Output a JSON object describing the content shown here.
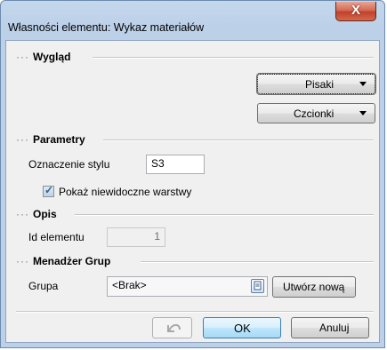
{
  "window": {
    "title": "Własności elementu: Wykaz materiałów",
    "close_glyph": "X"
  },
  "sections": {
    "appearance": {
      "title": "Wygląd",
      "dots": "···"
    },
    "parameters": {
      "title": "Parametry",
      "dots": "···"
    },
    "description": {
      "title": "Opis",
      "dots": "···"
    },
    "group_manager": {
      "title": "Menadżer Grup",
      "dots": "···"
    }
  },
  "appearance": {
    "pens_label": "Pisaki",
    "fonts_label": "Czcionki"
  },
  "parameters": {
    "style_label": "Oznaczenie stylu",
    "style_value": "S3",
    "show_hidden_label": "Pokaż niewidoczne warstwy",
    "show_hidden_checked": true
  },
  "description": {
    "element_id_label": "Id elementu",
    "element_id_value": "1"
  },
  "group_manager": {
    "group_label": "Grupa",
    "group_value": "<Brak>",
    "create_new_label": "Utwórz nową"
  },
  "footer": {
    "ok_label": "OK",
    "cancel_label": "Anuluj",
    "undo_icon": "undo-icon"
  },
  "colors": {
    "title_bar": "#bcd0e8",
    "close_button": "#c0412a",
    "client_bg": "#f0f0f0",
    "ok_focus_border": "#3c7fb1"
  }
}
